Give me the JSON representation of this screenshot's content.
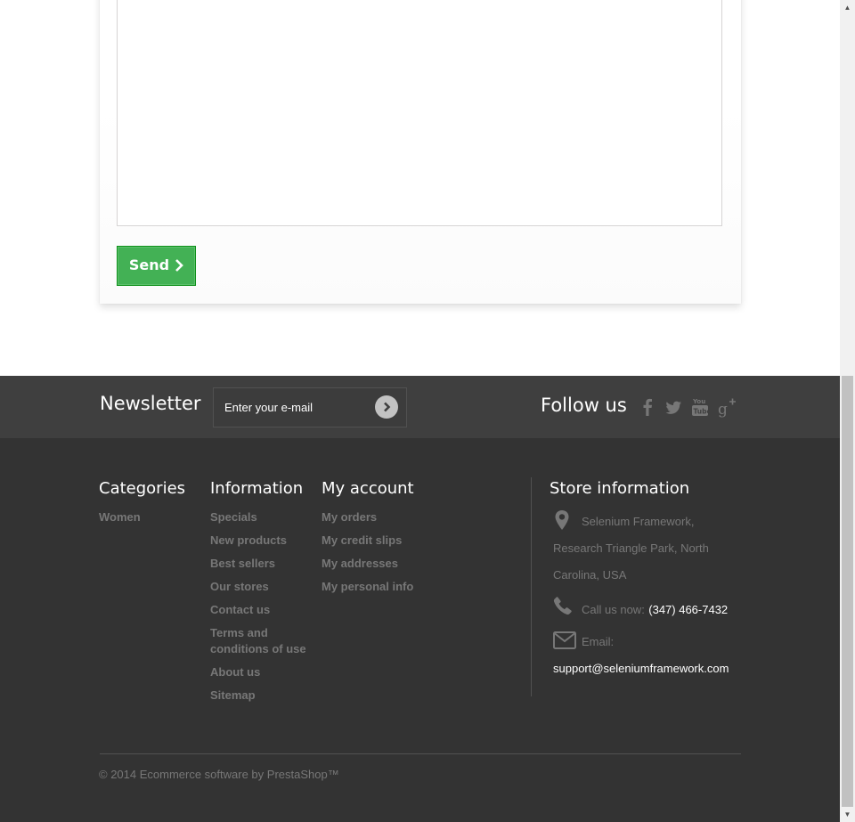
{
  "contact_form": {
    "message_value": "",
    "send_label": "Send",
    "send_chevron": "›"
  },
  "newsletter": {
    "title": "Newsletter",
    "email_placeholder": "Enter your e-mail",
    "submit_glyph": "›"
  },
  "follow": {
    "title": "Follow us",
    "networks": [
      "facebook-icon",
      "twitter-icon",
      "youtube-icon",
      "google-plus-icon"
    ]
  },
  "footer": {
    "categories": {
      "title": "Categories",
      "items": [
        "Women"
      ]
    },
    "information": {
      "title": "Information",
      "items": [
        "Specials",
        "New products",
        "Best sellers",
        "Our stores",
        "Contact us",
        "Terms and conditions of use",
        "About us",
        "Sitemap"
      ]
    },
    "account": {
      "title": "My account",
      "items": [
        "My orders",
        "My credit slips",
        "My addresses",
        "My personal info"
      ]
    },
    "store": {
      "title": "Store information",
      "address_line1": "Selenium Framework,",
      "address_line2": "Research Triangle Park, North",
      "address_line3": "Carolina, USA",
      "phone_label": "Call us now:",
      "phone": "(347) 466-7432",
      "email_label": "Email:",
      "email": "support@seleniumframework.com"
    },
    "copyright": "© 2014 Ecommerce software by PrestaShop™"
  },
  "colors": {
    "send_green": "#43b155",
    "newsletter_bar": "#3f3f3f",
    "footer_bg": "#333333",
    "link_gray": "#777777"
  }
}
